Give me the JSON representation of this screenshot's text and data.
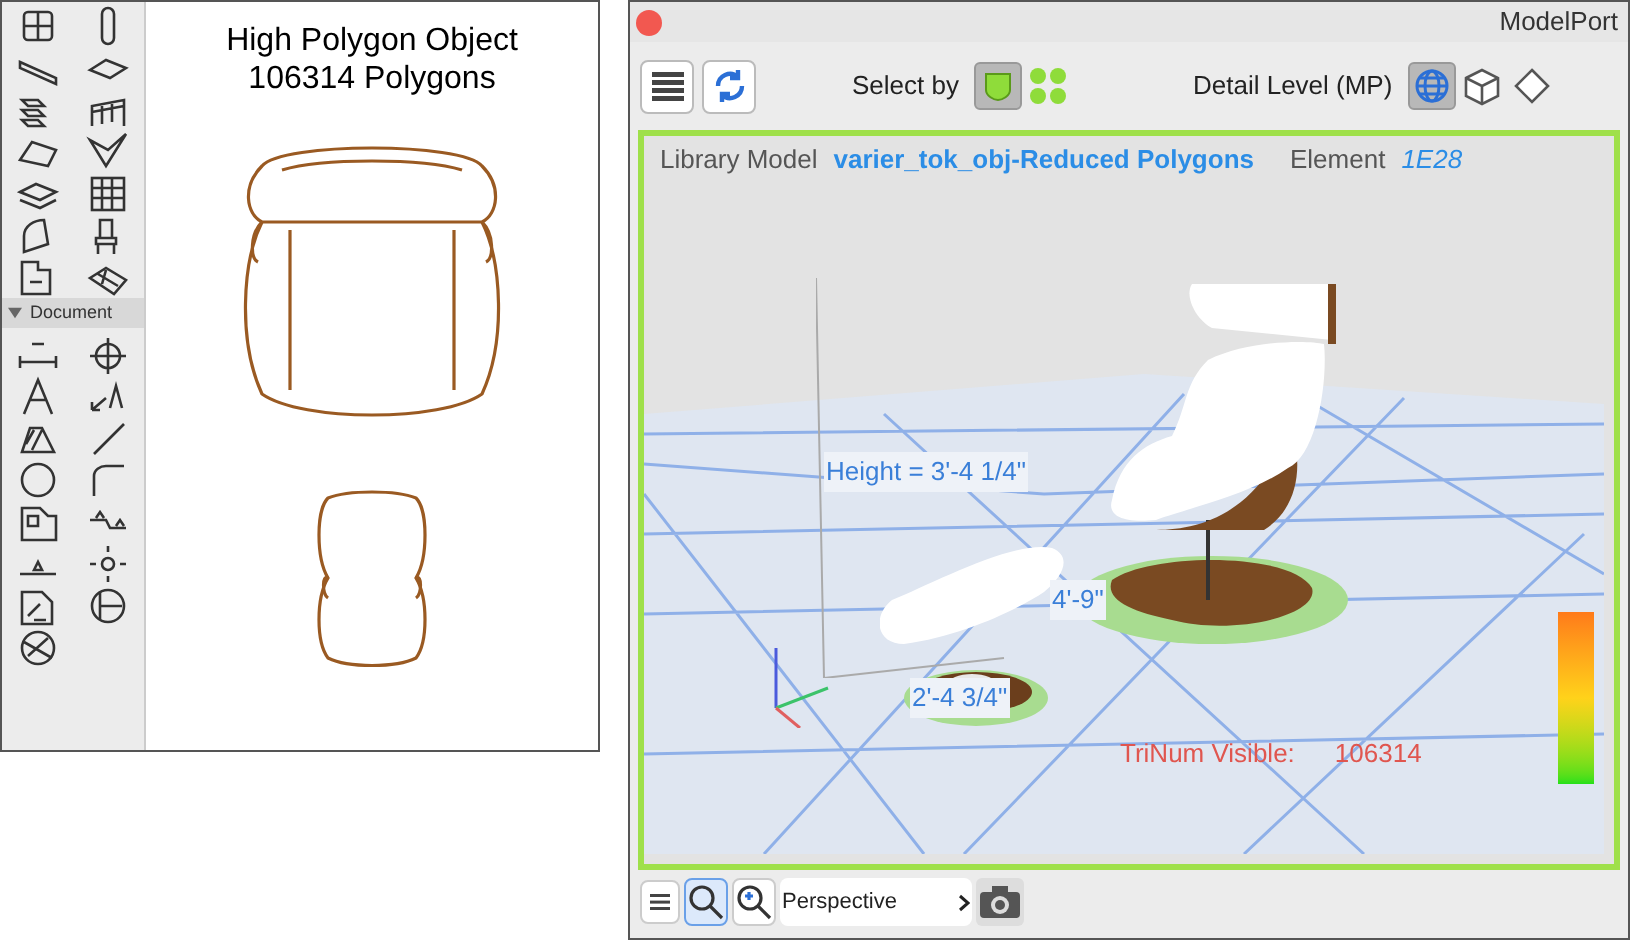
{
  "drawing_panel": {
    "palette_section": {
      "label": "Document",
      "expanded": true
    },
    "title_lines": [
      "High Polygon Object",
      "106314 Polygons"
    ]
  },
  "modelport": {
    "title": "ModelPort",
    "select_by": {
      "label": "Select by",
      "options": [
        {
          "kind": "shield",
          "selected": true
        },
        {
          "kind": "cluster",
          "selected": false
        }
      ]
    },
    "detail_level": {
      "label": "Detail Level (MP)",
      "options": [
        {
          "kind": "globe",
          "selected": true
        },
        {
          "kind": "cube",
          "selected": false
        },
        {
          "kind": "diamond",
          "selected": false
        }
      ]
    },
    "info": {
      "library_label": "Library Model",
      "library_value": "varier_tok_obj-Reduced Polygons",
      "element_label": "Element",
      "element_value": "1E28"
    },
    "annotations": {
      "height": "Height = 3'-4 1/4\"",
      "width": "4'-9\"",
      "depth": "2'-4 3/4\""
    },
    "stats": {
      "label": "TriNum Visible:",
      "value": "106314"
    },
    "bottom_bar": {
      "zoom_tools": [
        {
          "kind": "zoom",
          "selected": true
        },
        {
          "kind": "zoom-in",
          "selected": false
        }
      ],
      "view": "Perspective"
    }
  }
}
